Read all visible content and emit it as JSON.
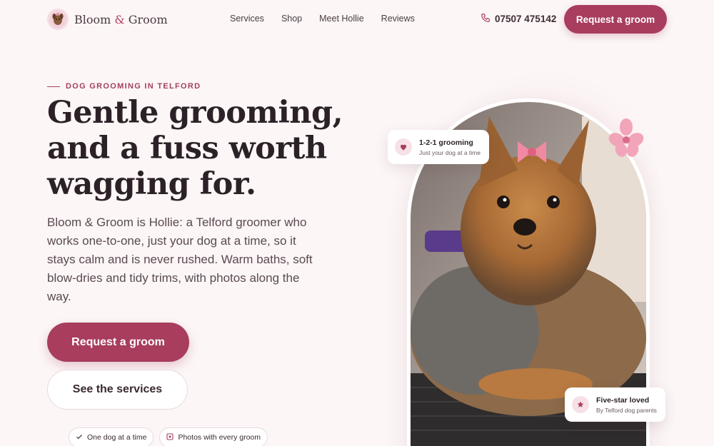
{
  "brand": {
    "name_part1": "Bloom ",
    "amp": "&",
    "name_part2": " Groom"
  },
  "nav": {
    "items": [
      "Services",
      "Shop",
      "Meet Hollie",
      "Reviews"
    ]
  },
  "header": {
    "phone": "07507 475142",
    "cta_label": "Request a groom"
  },
  "hero": {
    "eyebrow": "DOG GROOMING IN TELFORD",
    "headline_line1": "Gentle grooming,",
    "headline_line2": "and a fuss worth",
    "headline_line3": "wagging for.",
    "lead": "Bloom & Groom is Hollie: a Telford groomer who works one-to-one, just your dog at a time, so it stays calm and is never rushed. Warm baths, soft blow-dries and tidy trims, with photos along the way.",
    "primary_cta": "Request a groom",
    "secondary_cta": "See the services",
    "pills": [
      "One dog at a time",
      "Photos with every groom"
    ]
  },
  "cards": {
    "a_title": "1-2-1 grooming",
    "a_sub": "Just your dog at a time",
    "b_title": "Five-star loved",
    "b_sub": "By Telford dog parents"
  },
  "colors": {
    "accent": "#a83d5e",
    "background": "#fcf6f6",
    "pink_soft": "#f6e1e7"
  },
  "icons": [
    "logo-dog-icon",
    "phone-icon",
    "check-icon",
    "photo-icon",
    "heart-icon",
    "star-icon",
    "flower-icon"
  ]
}
